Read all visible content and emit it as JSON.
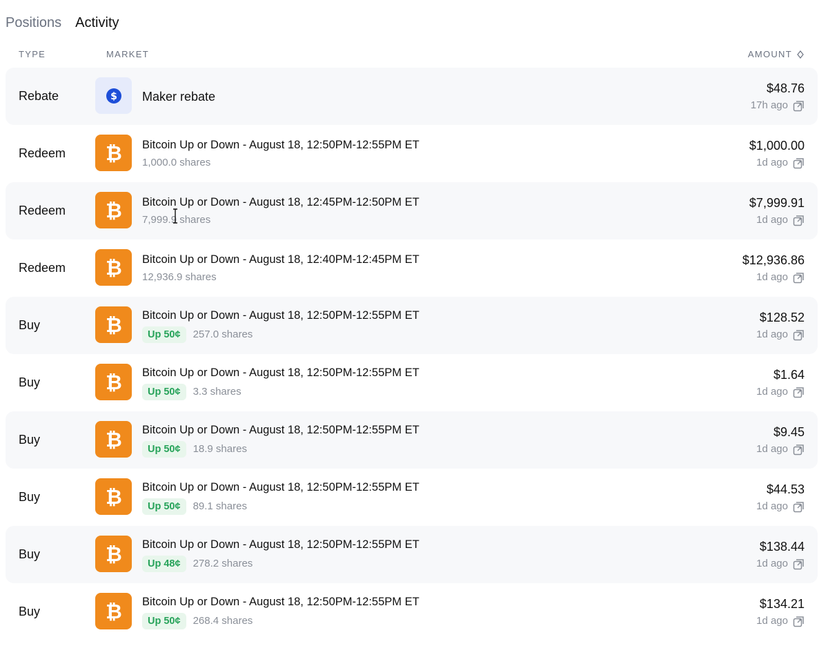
{
  "tabs": [
    {
      "label": "Positions",
      "active": false
    },
    {
      "label": "Activity",
      "active": true
    }
  ],
  "table_header": {
    "type": "TYPE",
    "market": "MARKET",
    "amount": "AMOUNT"
  },
  "colors": {
    "bitcoin_orange": "#f08a1c",
    "rebate_blue": "#1d4ed8",
    "outcome_green": "#27a35a",
    "muted_text": "#8a8f98"
  },
  "rows": [
    {
      "type": "Rebate",
      "icon": "dollar-coin-icon",
      "title": "Maker rebate",
      "outcome": "",
      "shares": "",
      "amount": "$48.76",
      "time": "17h ago"
    },
    {
      "type": "Redeem",
      "icon": "bitcoin-icon",
      "title": "Bitcoin Up or Down - August 18, 12:50PM-12:55PM ET",
      "outcome": "",
      "shares": "1,000.0 shares",
      "amount": "$1,000.00",
      "time": "1d ago"
    },
    {
      "type": "Redeem",
      "icon": "bitcoin-icon",
      "title": "Bitcoin Up or Down - August 18, 12:45PM-12:50PM ET",
      "outcome": "",
      "shares": "7,999.9 shares",
      "amount": "$7,999.91",
      "time": "1d ago"
    },
    {
      "type": "Redeem",
      "icon": "bitcoin-icon",
      "title": "Bitcoin Up or Down - August 18, 12:40PM-12:45PM ET",
      "outcome": "",
      "shares": "12,936.9 shares",
      "amount": "$12,936.86",
      "time": "1d ago"
    },
    {
      "type": "Buy",
      "icon": "bitcoin-icon",
      "title": "Bitcoin Up or Down - August 18, 12:50PM-12:55PM ET",
      "outcome": "Up 50¢",
      "shares": "257.0 shares",
      "amount": "$128.52",
      "time": "1d ago"
    },
    {
      "type": "Buy",
      "icon": "bitcoin-icon",
      "title": "Bitcoin Up or Down - August 18, 12:50PM-12:55PM ET",
      "outcome": "Up 50¢",
      "shares": "3.3 shares",
      "amount": "$1.64",
      "time": "1d ago"
    },
    {
      "type": "Buy",
      "icon": "bitcoin-icon",
      "title": "Bitcoin Up or Down - August 18, 12:50PM-12:55PM ET",
      "outcome": "Up 50¢",
      "shares": "18.9 shares",
      "amount": "$9.45",
      "time": "1d ago"
    },
    {
      "type": "Buy",
      "icon": "bitcoin-icon",
      "title": "Bitcoin Up or Down - August 18, 12:50PM-12:55PM ET",
      "outcome": "Up 50¢",
      "shares": "89.1 shares",
      "amount": "$44.53",
      "time": "1d ago"
    },
    {
      "type": "Buy",
      "icon": "bitcoin-icon",
      "title": "Bitcoin Up or Down - August 18, 12:50PM-12:55PM ET",
      "outcome": "Up 48¢",
      "shares": "278.2 shares",
      "amount": "$138.44",
      "time": "1d ago"
    },
    {
      "type": "Buy",
      "icon": "bitcoin-icon",
      "title": "Bitcoin Up or Down - August 18, 12:50PM-12:55PM ET",
      "outcome": "Up 50¢",
      "shares": "268.4 shares",
      "amount": "$134.21",
      "time": "1d ago"
    }
  ]
}
